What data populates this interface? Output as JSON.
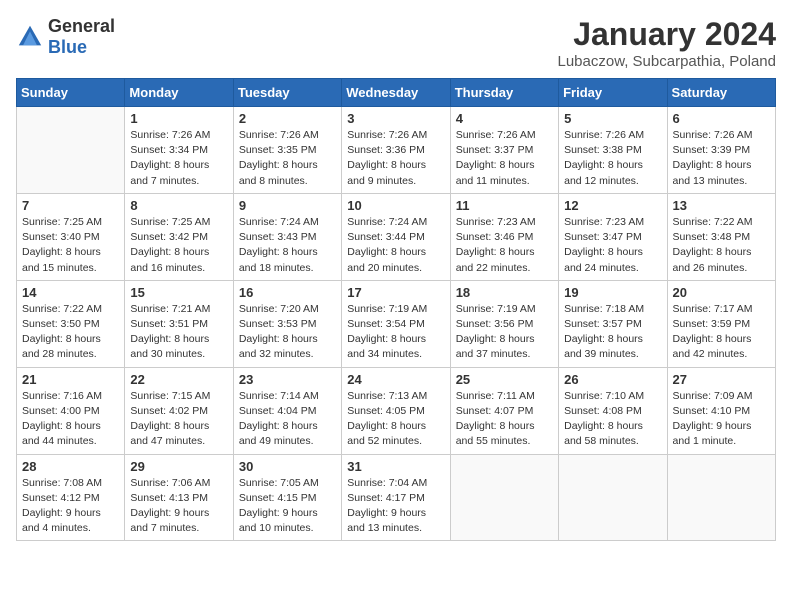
{
  "logo": {
    "general": "General",
    "blue": "Blue"
  },
  "title": "January 2024",
  "subtitle": "Lubaczow, Subcarpathia, Poland",
  "weekdays": [
    "Sunday",
    "Monday",
    "Tuesday",
    "Wednesday",
    "Thursday",
    "Friday",
    "Saturday"
  ],
  "weeks": [
    [
      {
        "day": "",
        "info": ""
      },
      {
        "day": "1",
        "info": "Sunrise: 7:26 AM\nSunset: 3:34 PM\nDaylight: 8 hours\nand 7 minutes."
      },
      {
        "day": "2",
        "info": "Sunrise: 7:26 AM\nSunset: 3:35 PM\nDaylight: 8 hours\nand 8 minutes."
      },
      {
        "day": "3",
        "info": "Sunrise: 7:26 AM\nSunset: 3:36 PM\nDaylight: 8 hours\nand 9 minutes."
      },
      {
        "day": "4",
        "info": "Sunrise: 7:26 AM\nSunset: 3:37 PM\nDaylight: 8 hours\nand 11 minutes."
      },
      {
        "day": "5",
        "info": "Sunrise: 7:26 AM\nSunset: 3:38 PM\nDaylight: 8 hours\nand 12 minutes."
      },
      {
        "day": "6",
        "info": "Sunrise: 7:26 AM\nSunset: 3:39 PM\nDaylight: 8 hours\nand 13 minutes."
      }
    ],
    [
      {
        "day": "7",
        "info": "Sunrise: 7:25 AM\nSunset: 3:40 PM\nDaylight: 8 hours\nand 15 minutes."
      },
      {
        "day": "8",
        "info": "Sunrise: 7:25 AM\nSunset: 3:42 PM\nDaylight: 8 hours\nand 16 minutes."
      },
      {
        "day": "9",
        "info": "Sunrise: 7:24 AM\nSunset: 3:43 PM\nDaylight: 8 hours\nand 18 minutes."
      },
      {
        "day": "10",
        "info": "Sunrise: 7:24 AM\nSunset: 3:44 PM\nDaylight: 8 hours\nand 20 minutes."
      },
      {
        "day": "11",
        "info": "Sunrise: 7:23 AM\nSunset: 3:46 PM\nDaylight: 8 hours\nand 22 minutes."
      },
      {
        "day": "12",
        "info": "Sunrise: 7:23 AM\nSunset: 3:47 PM\nDaylight: 8 hours\nand 24 minutes."
      },
      {
        "day": "13",
        "info": "Sunrise: 7:22 AM\nSunset: 3:48 PM\nDaylight: 8 hours\nand 26 minutes."
      }
    ],
    [
      {
        "day": "14",
        "info": "Sunrise: 7:22 AM\nSunset: 3:50 PM\nDaylight: 8 hours\nand 28 minutes."
      },
      {
        "day": "15",
        "info": "Sunrise: 7:21 AM\nSunset: 3:51 PM\nDaylight: 8 hours\nand 30 minutes."
      },
      {
        "day": "16",
        "info": "Sunrise: 7:20 AM\nSunset: 3:53 PM\nDaylight: 8 hours\nand 32 minutes."
      },
      {
        "day": "17",
        "info": "Sunrise: 7:19 AM\nSunset: 3:54 PM\nDaylight: 8 hours\nand 34 minutes."
      },
      {
        "day": "18",
        "info": "Sunrise: 7:19 AM\nSunset: 3:56 PM\nDaylight: 8 hours\nand 37 minutes."
      },
      {
        "day": "19",
        "info": "Sunrise: 7:18 AM\nSunset: 3:57 PM\nDaylight: 8 hours\nand 39 minutes."
      },
      {
        "day": "20",
        "info": "Sunrise: 7:17 AM\nSunset: 3:59 PM\nDaylight: 8 hours\nand 42 minutes."
      }
    ],
    [
      {
        "day": "21",
        "info": "Sunrise: 7:16 AM\nSunset: 4:00 PM\nDaylight: 8 hours\nand 44 minutes."
      },
      {
        "day": "22",
        "info": "Sunrise: 7:15 AM\nSunset: 4:02 PM\nDaylight: 8 hours\nand 47 minutes."
      },
      {
        "day": "23",
        "info": "Sunrise: 7:14 AM\nSunset: 4:04 PM\nDaylight: 8 hours\nand 49 minutes."
      },
      {
        "day": "24",
        "info": "Sunrise: 7:13 AM\nSunset: 4:05 PM\nDaylight: 8 hours\nand 52 minutes."
      },
      {
        "day": "25",
        "info": "Sunrise: 7:11 AM\nSunset: 4:07 PM\nDaylight: 8 hours\nand 55 minutes."
      },
      {
        "day": "26",
        "info": "Sunrise: 7:10 AM\nSunset: 4:08 PM\nDaylight: 8 hours\nand 58 minutes."
      },
      {
        "day": "27",
        "info": "Sunrise: 7:09 AM\nSunset: 4:10 PM\nDaylight: 9 hours\nand 1 minute."
      }
    ],
    [
      {
        "day": "28",
        "info": "Sunrise: 7:08 AM\nSunset: 4:12 PM\nDaylight: 9 hours\nand 4 minutes."
      },
      {
        "day": "29",
        "info": "Sunrise: 7:06 AM\nSunset: 4:13 PM\nDaylight: 9 hours\nand 7 minutes."
      },
      {
        "day": "30",
        "info": "Sunrise: 7:05 AM\nSunset: 4:15 PM\nDaylight: 9 hours\nand 10 minutes."
      },
      {
        "day": "31",
        "info": "Sunrise: 7:04 AM\nSunset: 4:17 PM\nDaylight: 9 hours\nand 13 minutes."
      },
      {
        "day": "",
        "info": ""
      },
      {
        "day": "",
        "info": ""
      },
      {
        "day": "",
        "info": ""
      }
    ]
  ]
}
